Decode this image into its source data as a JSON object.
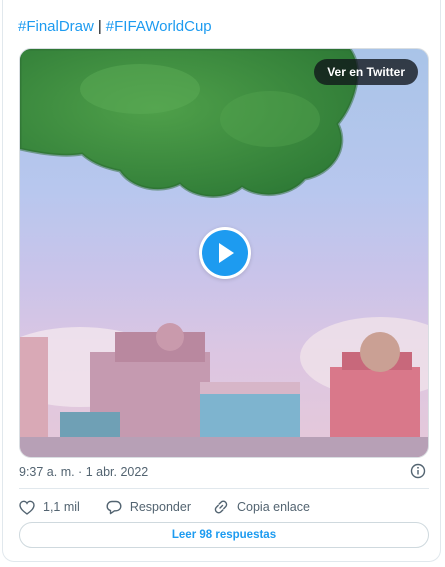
{
  "tweet": {
    "hashtags": [
      "#FinalDraw",
      "#FIFAWorldCup"
    ],
    "separator": "|",
    "timestamp": "9:37 a. m. · 1 abr. 2022"
  },
  "media": {
    "view_button_label": "Ver en Twitter",
    "play_icon": "play-icon"
  },
  "actions": {
    "likes": "1,1 mil",
    "reply_label": "Responder",
    "copy_link_label": "Copia enlace",
    "read_replies_label": "Leer 98 respuestas"
  },
  "colors": {
    "accent": "#1d9bf0",
    "muted_text": "#536471",
    "border": "#e1e8ed"
  }
}
